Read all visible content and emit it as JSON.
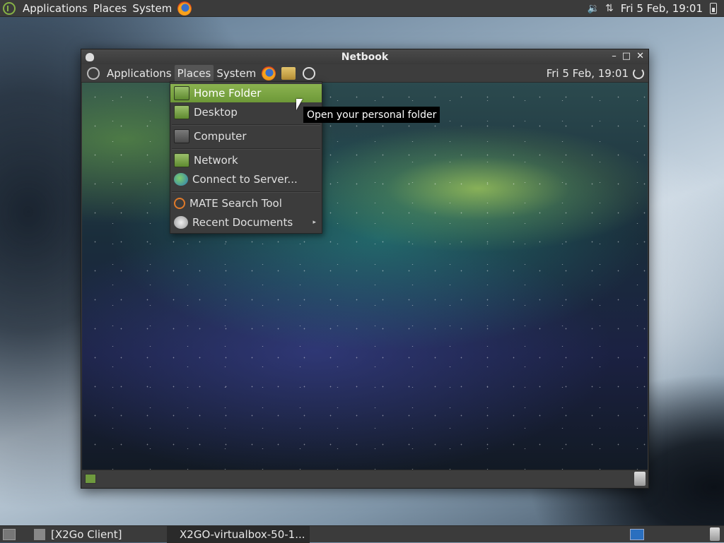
{
  "top_panel": {
    "menus": [
      "Applications",
      "Places",
      "System"
    ],
    "clock": "Fri  5 Feb, 19:01"
  },
  "window": {
    "title": "Netbook",
    "controls": {
      "minimize": "–",
      "maximize": "□",
      "close": "✕"
    },
    "panel": {
      "menus": [
        "Applications",
        "Places",
        "System"
      ],
      "clock": "Fri  5 Feb, 19:01"
    }
  },
  "places_menu": {
    "items": [
      {
        "label": "Home Folder",
        "icon": "home-folder-icon",
        "highlighted": true
      },
      {
        "label": "Desktop",
        "icon": "desktop-folder-icon"
      },
      {
        "label": "Computer",
        "icon": "computer-icon"
      },
      {
        "label": "Network",
        "icon": "network-icon"
      },
      {
        "label": "Connect to Server...",
        "icon": "globe-icon"
      },
      {
        "label": "MATE Search Tool",
        "icon": "search-icon"
      },
      {
        "label": "Recent Documents",
        "icon": "recent-icon",
        "submenu": true
      }
    ],
    "submenu_arrow": "▸"
  },
  "tooltip": "Open your personal folder",
  "taskbar": {
    "tasks": [
      {
        "label": "[X2Go Client]",
        "active": false
      },
      {
        "label": "X2GO-virtualbox-50-1...",
        "active": true
      }
    ]
  }
}
